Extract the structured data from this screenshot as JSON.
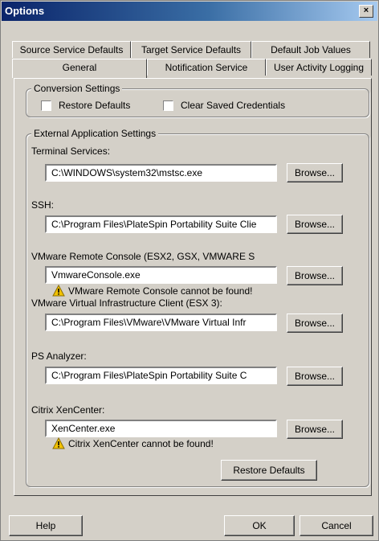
{
  "window": {
    "title": "Options",
    "close_label": "×"
  },
  "tabs": {
    "row_top": [
      "Source Service Defaults",
      "Target Service Defaults",
      "Default Job Values"
    ],
    "row_bottom": [
      "General",
      "Notification Service",
      "User Activity Logging"
    ],
    "active": "General"
  },
  "conversion": {
    "legend": "Conversion Settings",
    "restore_defaults": "Restore Defaults",
    "clear_credentials": "Clear Saved Credentials"
  },
  "external": {
    "legend": "External Application Settings",
    "browse_label": "Browse...",
    "terminal": {
      "label": "Terminal Services:",
      "value": "C:\\WINDOWS\\system32\\mstsc.exe"
    },
    "ssh": {
      "label": "SSH:",
      "value": "C:\\Program Files\\PlateSpin Portability Suite Clie"
    },
    "vmware_console": {
      "label": "VMware Remote Console (ESX2, GSX, VMWARE S",
      "value": "VmwareConsole.exe",
      "warning": "VMware Remote Console cannot be found!"
    },
    "vi_client": {
      "label": "VMware Virtual Infrastructure Client (ESX 3):",
      "value": "C:\\Program Files\\VMware\\VMware Virtual Infr"
    },
    "ps_analyzer": {
      "label": "PS Analyzer:",
      "value": "C:\\Program Files\\PlateSpin Portability Suite C"
    },
    "xencenter": {
      "label": "Citrix XenCenter:",
      "value": "XenCenter.exe",
      "warning": "Citrix XenCenter cannot be found!"
    },
    "restore_defaults_button": "Restore Defaults"
  },
  "footer": {
    "help": "Help",
    "ok": "OK",
    "cancel": "Cancel"
  },
  "colors": {
    "dialog_bg": "#d4d0c8",
    "title_start": "#0a246a",
    "title_end": "#a6caf0",
    "warning": "#f2c200"
  },
  "icons": {
    "warning": "warning-icon"
  }
}
